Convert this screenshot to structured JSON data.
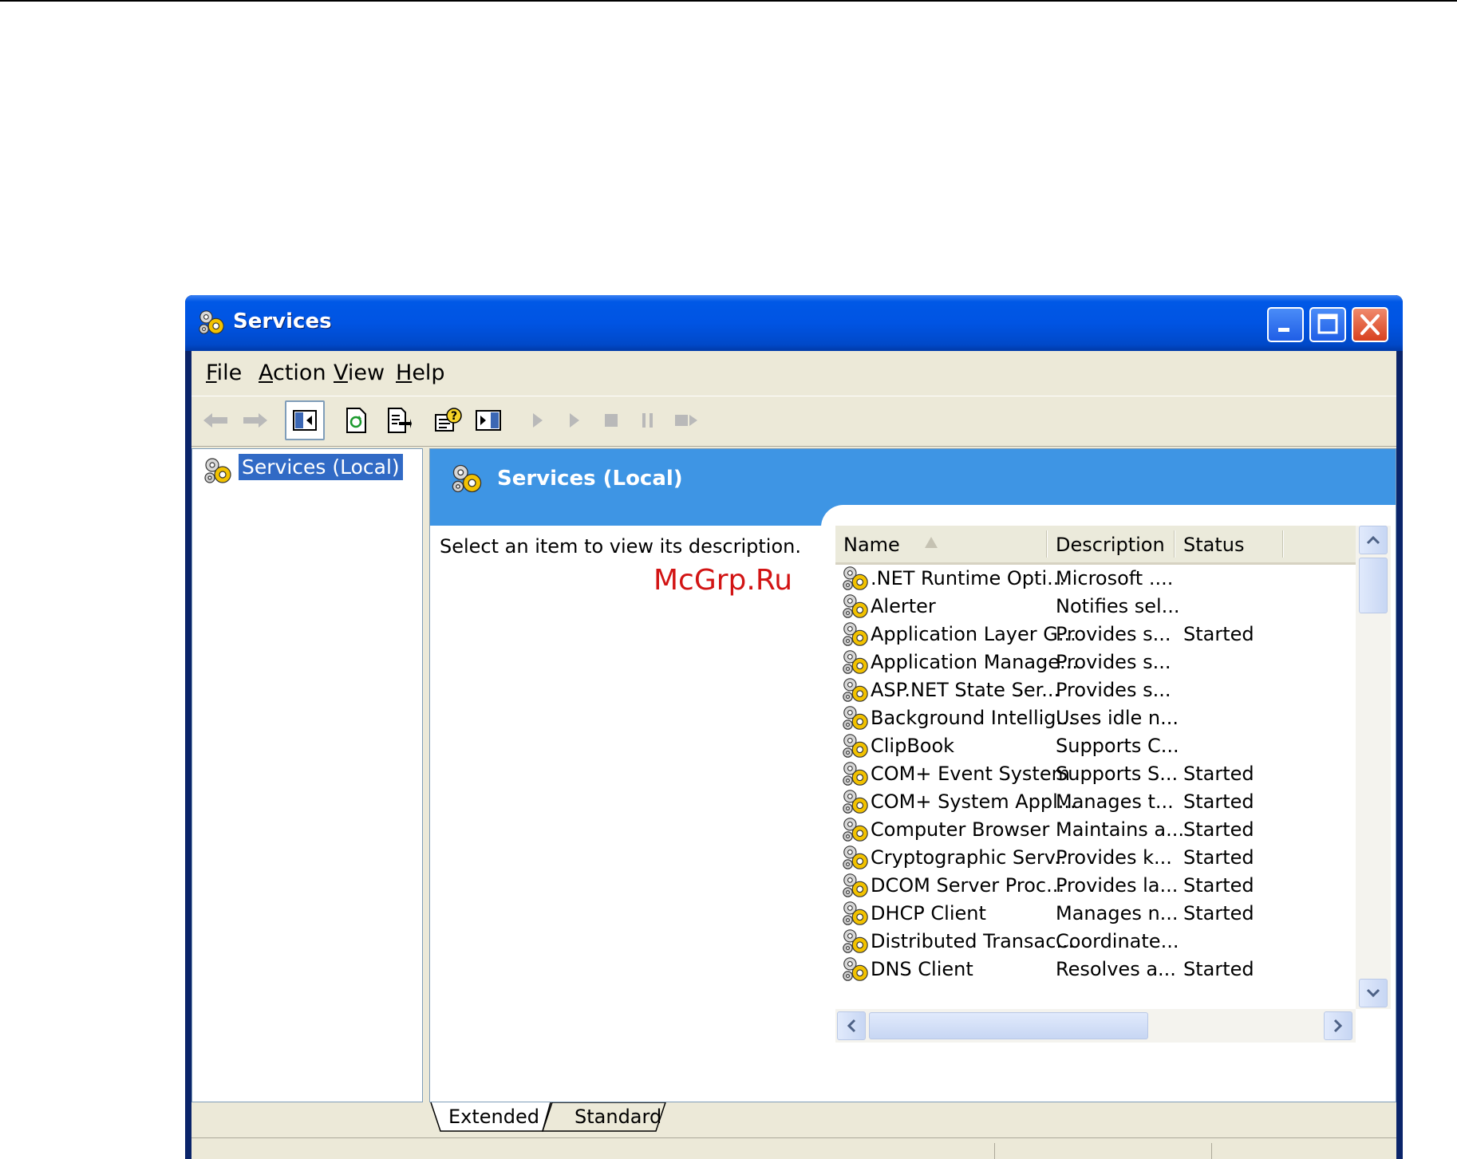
{
  "window": {
    "title": "Services"
  },
  "menu": [
    {
      "key": "F",
      "rest": "ile"
    },
    {
      "key": "A",
      "rest": "ction"
    },
    {
      "key": "V",
      "rest": "iew"
    },
    {
      "key": "H",
      "rest": "elp"
    }
  ],
  "tree": {
    "root_label": "Services (Local)"
  },
  "banner": {
    "title": "Services (Local)"
  },
  "description": {
    "prompt": "Select an item to view its description."
  },
  "watermark": "McGrp.Ru",
  "columns": {
    "name": "Name",
    "description": "Description",
    "status": "Status"
  },
  "services": [
    {
      "name": ".NET Runtime Opti...",
      "description": "Microsoft ....",
      "status": ""
    },
    {
      "name": "Alerter",
      "description": "Notifies sel...",
      "status": ""
    },
    {
      "name": "Application Layer G...",
      "description": "Provides s...",
      "status": "Started"
    },
    {
      "name": "Application Manage...",
      "description": "Provides s...",
      "status": ""
    },
    {
      "name": "ASP.NET State Ser...",
      "description": "Provides s...",
      "status": ""
    },
    {
      "name": "Background Intellig...",
      "description": "Uses idle n...",
      "status": ""
    },
    {
      "name": "ClipBook",
      "description": "Supports C...",
      "status": ""
    },
    {
      "name": "COM+ Event System",
      "description": "Supports S...",
      "status": "Started"
    },
    {
      "name": "COM+ System Appl...",
      "description": "Manages t...",
      "status": "Started"
    },
    {
      "name": "Computer Browser",
      "description": "Maintains a...",
      "status": "Started"
    },
    {
      "name": "Cryptographic Serv...",
      "description": "Provides k...",
      "status": "Started"
    },
    {
      "name": "DCOM Server Proc...",
      "description": "Provides la...",
      "status": "Started"
    },
    {
      "name": "DHCP Client",
      "description": "Manages n...",
      "status": "Started"
    },
    {
      "name": "Distributed Transac...",
      "description": "Coordinate...",
      "status": ""
    },
    {
      "name": "DNS Client",
      "description": "Resolves a...",
      "status": "Started"
    }
  ],
  "tabs": {
    "extended": "Extended",
    "standard": "Standard"
  },
  "icons": {
    "service": "gears-icon",
    "back": "back-arrow-icon",
    "forward": "forward-arrow-icon",
    "toggle_tree": "show-hide-tree-icon",
    "refresh": "refresh-icon",
    "export": "export-list-icon",
    "help": "help-icon",
    "action_pane": "action-pane-icon",
    "start": "play-icon",
    "start_alt": "play-icon",
    "stop": "stop-icon",
    "pause": "pause-icon",
    "restart": "restart-icon"
  },
  "colors": {
    "titlebar": "#0054e3",
    "banner": "#3e95e4",
    "selection": "#316ac5",
    "watermark": "#d21414"
  }
}
